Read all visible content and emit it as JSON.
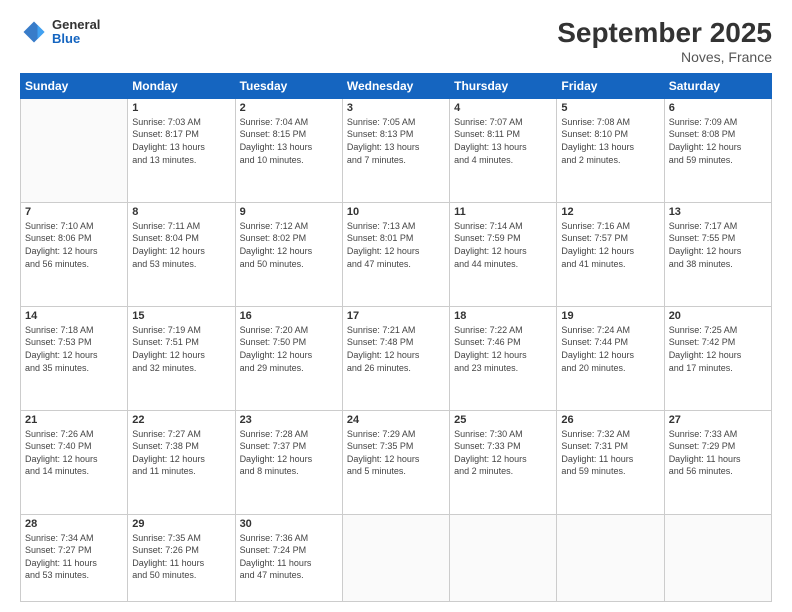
{
  "logo": {
    "general": "General",
    "blue": "Blue"
  },
  "title": "September 2025",
  "subtitle": "Noves, France",
  "days_header": [
    "Sunday",
    "Monday",
    "Tuesday",
    "Wednesday",
    "Thursday",
    "Friday",
    "Saturday"
  ],
  "weeks": [
    [
      {
        "day": "",
        "info": ""
      },
      {
        "day": "1",
        "info": "Sunrise: 7:03 AM\nSunset: 8:17 PM\nDaylight: 13 hours\nand 13 minutes."
      },
      {
        "day": "2",
        "info": "Sunrise: 7:04 AM\nSunset: 8:15 PM\nDaylight: 13 hours\nand 10 minutes."
      },
      {
        "day": "3",
        "info": "Sunrise: 7:05 AM\nSunset: 8:13 PM\nDaylight: 13 hours\nand 7 minutes."
      },
      {
        "day": "4",
        "info": "Sunrise: 7:07 AM\nSunset: 8:11 PM\nDaylight: 13 hours\nand 4 minutes."
      },
      {
        "day": "5",
        "info": "Sunrise: 7:08 AM\nSunset: 8:10 PM\nDaylight: 13 hours\nand 2 minutes."
      },
      {
        "day": "6",
        "info": "Sunrise: 7:09 AM\nSunset: 8:08 PM\nDaylight: 12 hours\nand 59 minutes."
      }
    ],
    [
      {
        "day": "7",
        "info": "Sunrise: 7:10 AM\nSunset: 8:06 PM\nDaylight: 12 hours\nand 56 minutes."
      },
      {
        "day": "8",
        "info": "Sunrise: 7:11 AM\nSunset: 8:04 PM\nDaylight: 12 hours\nand 53 minutes."
      },
      {
        "day": "9",
        "info": "Sunrise: 7:12 AM\nSunset: 8:02 PM\nDaylight: 12 hours\nand 50 minutes."
      },
      {
        "day": "10",
        "info": "Sunrise: 7:13 AM\nSunset: 8:01 PM\nDaylight: 12 hours\nand 47 minutes."
      },
      {
        "day": "11",
        "info": "Sunrise: 7:14 AM\nSunset: 7:59 PM\nDaylight: 12 hours\nand 44 minutes."
      },
      {
        "day": "12",
        "info": "Sunrise: 7:16 AM\nSunset: 7:57 PM\nDaylight: 12 hours\nand 41 minutes."
      },
      {
        "day": "13",
        "info": "Sunrise: 7:17 AM\nSunset: 7:55 PM\nDaylight: 12 hours\nand 38 minutes."
      }
    ],
    [
      {
        "day": "14",
        "info": "Sunrise: 7:18 AM\nSunset: 7:53 PM\nDaylight: 12 hours\nand 35 minutes."
      },
      {
        "day": "15",
        "info": "Sunrise: 7:19 AM\nSunset: 7:51 PM\nDaylight: 12 hours\nand 32 minutes."
      },
      {
        "day": "16",
        "info": "Sunrise: 7:20 AM\nSunset: 7:50 PM\nDaylight: 12 hours\nand 29 minutes."
      },
      {
        "day": "17",
        "info": "Sunrise: 7:21 AM\nSunset: 7:48 PM\nDaylight: 12 hours\nand 26 minutes."
      },
      {
        "day": "18",
        "info": "Sunrise: 7:22 AM\nSunset: 7:46 PM\nDaylight: 12 hours\nand 23 minutes."
      },
      {
        "day": "19",
        "info": "Sunrise: 7:24 AM\nSunset: 7:44 PM\nDaylight: 12 hours\nand 20 minutes."
      },
      {
        "day": "20",
        "info": "Sunrise: 7:25 AM\nSunset: 7:42 PM\nDaylight: 12 hours\nand 17 minutes."
      }
    ],
    [
      {
        "day": "21",
        "info": "Sunrise: 7:26 AM\nSunset: 7:40 PM\nDaylight: 12 hours\nand 14 minutes."
      },
      {
        "day": "22",
        "info": "Sunrise: 7:27 AM\nSunset: 7:38 PM\nDaylight: 12 hours\nand 11 minutes."
      },
      {
        "day": "23",
        "info": "Sunrise: 7:28 AM\nSunset: 7:37 PM\nDaylight: 12 hours\nand 8 minutes."
      },
      {
        "day": "24",
        "info": "Sunrise: 7:29 AM\nSunset: 7:35 PM\nDaylight: 12 hours\nand 5 minutes."
      },
      {
        "day": "25",
        "info": "Sunrise: 7:30 AM\nSunset: 7:33 PM\nDaylight: 12 hours\nand 2 minutes."
      },
      {
        "day": "26",
        "info": "Sunrise: 7:32 AM\nSunset: 7:31 PM\nDaylight: 11 hours\nand 59 minutes."
      },
      {
        "day": "27",
        "info": "Sunrise: 7:33 AM\nSunset: 7:29 PM\nDaylight: 11 hours\nand 56 minutes."
      }
    ],
    [
      {
        "day": "28",
        "info": "Sunrise: 7:34 AM\nSunset: 7:27 PM\nDaylight: 11 hours\nand 53 minutes."
      },
      {
        "day": "29",
        "info": "Sunrise: 7:35 AM\nSunset: 7:26 PM\nDaylight: 11 hours\nand 50 minutes."
      },
      {
        "day": "30",
        "info": "Sunrise: 7:36 AM\nSunset: 7:24 PM\nDaylight: 11 hours\nand 47 minutes."
      },
      {
        "day": "",
        "info": ""
      },
      {
        "day": "",
        "info": ""
      },
      {
        "day": "",
        "info": ""
      },
      {
        "day": "",
        "info": ""
      }
    ]
  ]
}
